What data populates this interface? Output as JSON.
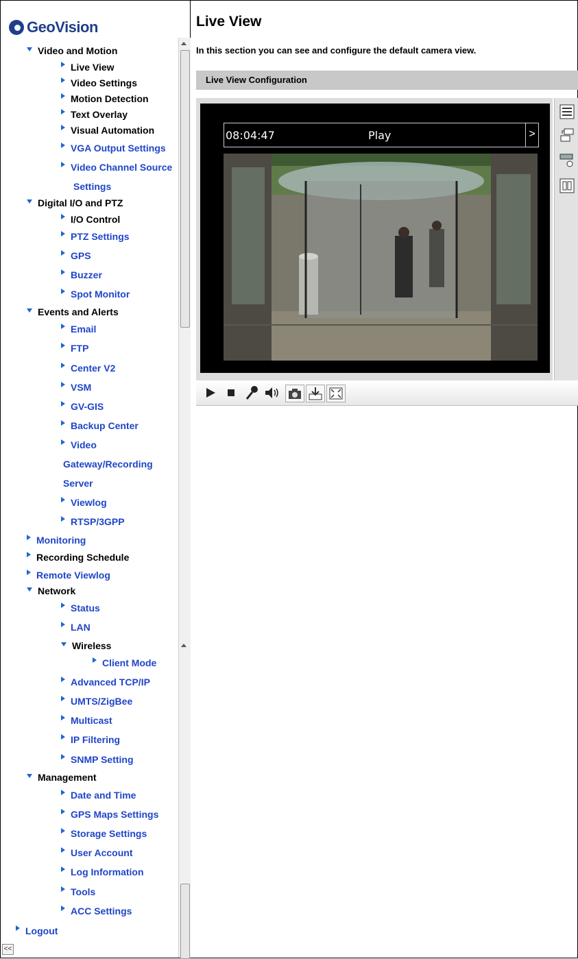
{
  "brand": {
    "logo_text": "GeoVision"
  },
  "page": {
    "title": "Live View",
    "description": "In this section you can see and configure the default camera view."
  },
  "section": {
    "title": "Live View Configuration"
  },
  "player": {
    "time": "08:04:47",
    "state": "Play",
    "next_symbol": ">"
  },
  "sidebar_toggle": "<<",
  "nav": {
    "video_and_motion": "Video and Motion",
    "live_view": "Live View",
    "video_settings": "Video Settings",
    "motion_detection": "Motion Detection",
    "text_overlay": "Text Overlay",
    "visual_automation": "Visual Automation",
    "vga_output_settings": "VGA Output Settings",
    "video_channel_source_1": "Video Channel Source",
    "video_channel_source_2": "Settings",
    "digital_io_ptz": "Digital I/O and PTZ",
    "io_control": "I/O Control",
    "ptz_settings": "PTZ Settings",
    "gps": "GPS",
    "buzzer": "Buzzer",
    "spot_monitor": "Spot Monitor",
    "events_alerts": "Events and Alerts",
    "email": "Email",
    "ftp": "FTP",
    "center_v2": "Center V2",
    "vsm": "VSM",
    "gv_gis": "GV-GIS",
    "backup_center": "Backup Center",
    "video_gateway_1": "Video",
    "video_gateway_2": "Gateway/Recording",
    "video_gateway_3": "Server",
    "viewlog": "Viewlog",
    "rtsp": "RTSP/3GPP",
    "monitoring": "Monitoring",
    "recording_schedule": "Recording Schedule",
    "remote_viewlog": "Remote Viewlog",
    "network": "Network",
    "status": "Status",
    "lan": "LAN",
    "wireless": "Wireless",
    "client_mode": "Client Mode",
    "advanced_tcpip": "Advanced TCP/IP",
    "umts_zigbee": "UMTS/ZigBee",
    "multicast": "Multicast",
    "ip_filtering": "IP Filtering",
    "snmp_setting": "SNMP Setting",
    "management": "Management",
    "date_time": "Date and Time",
    "gps_maps": "GPS Maps Settings",
    "storage": "Storage Settings",
    "user_account": "User Account",
    "log_information": "Log Information",
    "tools": "Tools",
    "acc_settings": "ACC Settings",
    "logout": "Logout"
  },
  "colors": {
    "link_blue": "#1f45c8",
    "arrow_blue": "#1f66d0",
    "brand_blue": "#1f3f8a",
    "section_gray": "#c8c8c8"
  },
  "icons": [
    "play-icon",
    "stop-icon",
    "microphone-icon",
    "speaker-icon",
    "snapshot-icon",
    "save-clip-icon",
    "fullscreen-icon",
    "settings-list-icon",
    "camera-switch-icon",
    "ptz-icon",
    "io-icon"
  ]
}
